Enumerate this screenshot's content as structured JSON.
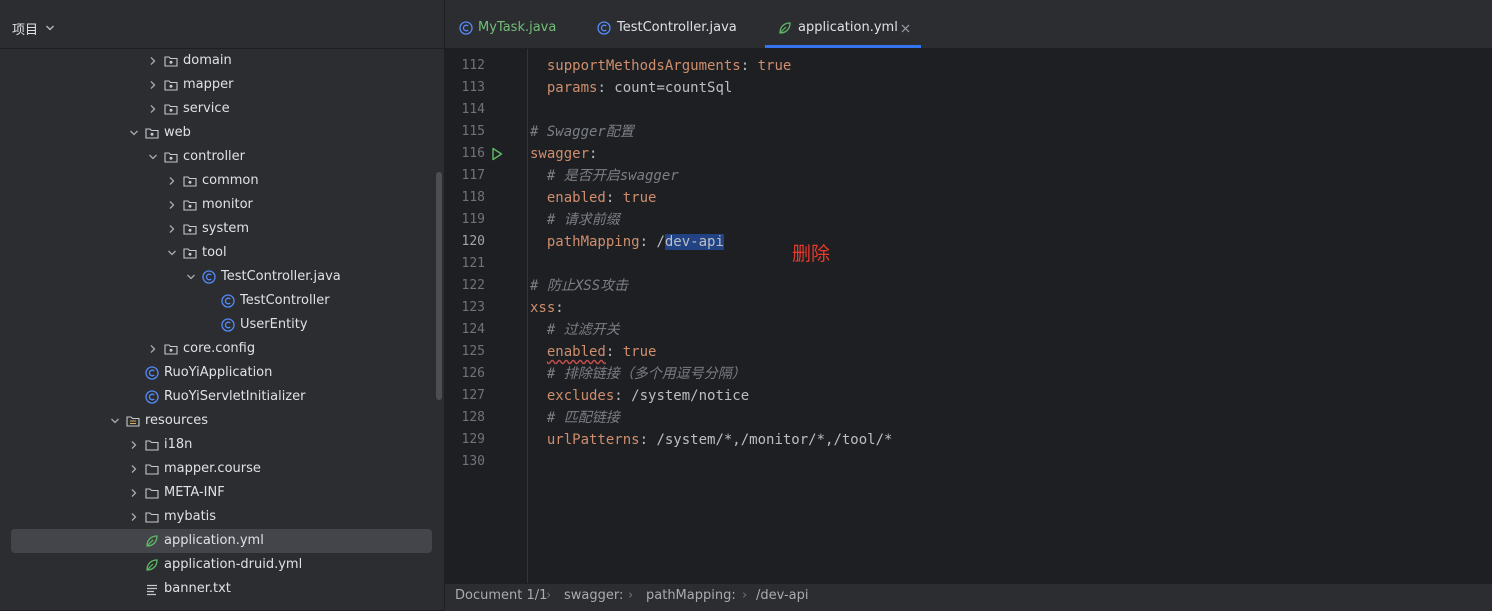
{
  "project_panel": {
    "title": "项目",
    "tree": [
      {
        "label": "domain",
        "type": "package",
        "expanded": false
      },
      {
        "label": "mapper",
        "type": "package",
        "expanded": false
      },
      {
        "label": "service",
        "type": "package",
        "expanded": false
      },
      {
        "label": "web",
        "type": "package",
        "expanded": true
      },
      {
        "label": "controller",
        "type": "package",
        "expanded": true
      },
      {
        "label": "common",
        "type": "package",
        "expanded": false
      },
      {
        "label": "monitor",
        "type": "package",
        "expanded": false
      },
      {
        "label": "system",
        "type": "package",
        "expanded": false
      },
      {
        "label": "tool",
        "type": "package",
        "expanded": true
      },
      {
        "label": "TestController.java",
        "type": "java-file",
        "expanded": true
      },
      {
        "label": "TestController",
        "type": "class"
      },
      {
        "label": "UserEntity",
        "type": "class"
      },
      {
        "label": "core.config",
        "type": "package",
        "expanded": false
      },
      {
        "label": "RuoYiApplication",
        "type": "class"
      },
      {
        "label": "RuoYiServletInitializer",
        "type": "class"
      },
      {
        "label": "resources",
        "type": "resources-folder",
        "expanded": true
      },
      {
        "label": "i18n",
        "type": "folder",
        "expanded": false
      },
      {
        "label": "mapper.course",
        "type": "folder",
        "expanded": false
      },
      {
        "label": "META-INF",
        "type": "folder",
        "expanded": false
      },
      {
        "label": "mybatis",
        "type": "folder",
        "expanded": false
      },
      {
        "label": "application.yml",
        "type": "yml",
        "selected": true
      },
      {
        "label": "application-druid.yml",
        "type": "yml"
      },
      {
        "label": "banner.txt",
        "type": "text"
      }
    ]
  },
  "tabs": [
    {
      "label": "MyTask.java",
      "icon": "class-icon",
      "active": false
    },
    {
      "label": "TestController.java",
      "icon": "class-icon",
      "active": false
    },
    {
      "label": "application.yml",
      "icon": "yml-icon",
      "active": true,
      "closable": true
    }
  ],
  "editor": {
    "lines": [
      {
        "number": "112",
        "text": "  supportMethodsArguments: true"
      },
      {
        "number": "113",
        "text": "  params: count=countSql"
      },
      {
        "number": "114",
        "text": ""
      },
      {
        "number": "115",
        "text": "# Swagger配置"
      },
      {
        "number": "116",
        "text": "swagger:"
      },
      {
        "number": "117",
        "text": "  # 是否开启swagger"
      },
      {
        "number": "118",
        "text": "  enabled: true"
      },
      {
        "number": "119",
        "text": "  # 请求前缀"
      },
      {
        "number": "120",
        "text": "  pathMapping: /dev-api"
      },
      {
        "number": "121",
        "text": ""
      },
      {
        "number": "122",
        "text": "# 防止XSS攻击"
      },
      {
        "number": "123",
        "text": "xss:"
      },
      {
        "number": "124",
        "text": "  # 过滤开关"
      },
      {
        "number": "125",
        "text": "  enabled: true"
      },
      {
        "number": "126",
        "text": "  # 排除链接（多个用逗号分隔）"
      },
      {
        "number": "127",
        "text": "  excludes: /system/notice"
      },
      {
        "number": "128",
        "text": "  # 匹配链接"
      },
      {
        "number": "129",
        "text": "  urlPatterns: /system/*,/monitor/*,/tool/*"
      },
      {
        "number": "130",
        "text": ""
      }
    ],
    "current_line": "120",
    "selected_text": "dev-api",
    "annotation": "删除"
  },
  "status_bar": {
    "breadcrumbs": [
      "Document 1/1",
      "swagger:",
      "pathMapping:",
      "/dev-api"
    ]
  },
  "colors": {
    "accent": "#3574f0",
    "annotation": "#e83a2b",
    "key": "#cf8e6d",
    "comment": "#7a7e85",
    "selection": "#214283"
  }
}
